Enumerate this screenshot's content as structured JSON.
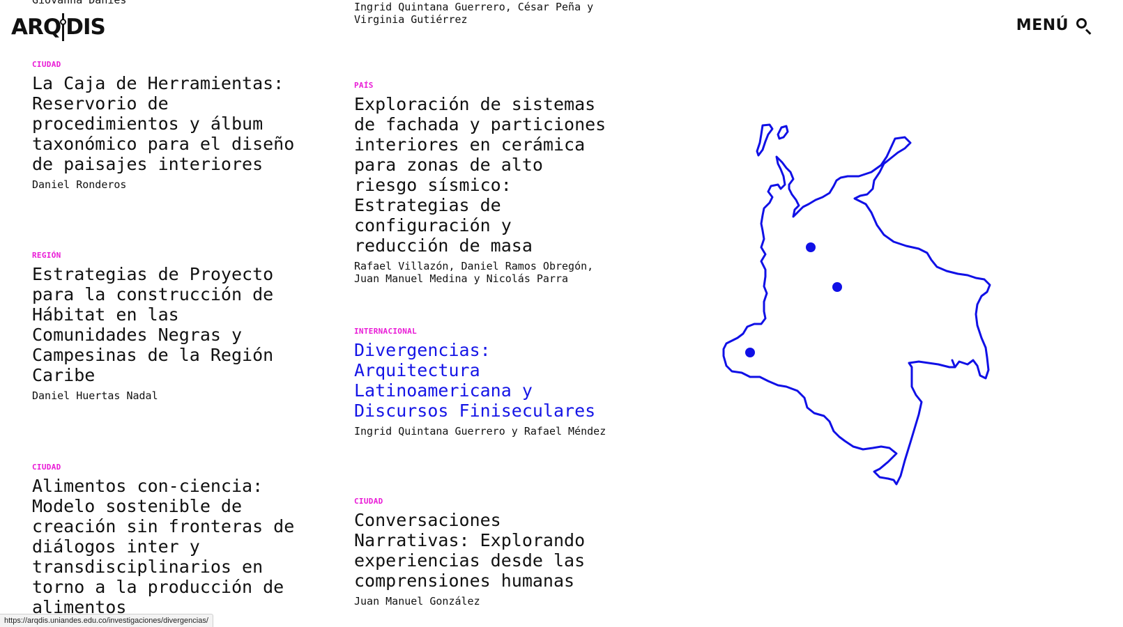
{
  "logo": {
    "left": "ARQ",
    "right": "DIS"
  },
  "header": {
    "menu_label": "MENÚ",
    "search_icon": "search-icon"
  },
  "cut_off": {
    "col1_top": "Giovanna Danies",
    "col2_top": "Ingrid Quintana Guerrero, César Peña y\nVirginia Gutiérrez"
  },
  "column1": [
    {
      "category": "CIUDAD",
      "title": "La Caja de Herramientas: Reservorio de procedimientos y álbum taxonómico para el diseño de paisajes interiores",
      "authors": "Daniel Ronderos"
    },
    {
      "category": "REGIÓN",
      "title": "Estrategias de Proyecto para la construcción de Hábitat en las Comunidades Negras y Campesinas de la Región Caribe",
      "authors": "Daniel Huertas Nadal"
    },
    {
      "category": "CIUDAD",
      "title": "Alimentos con-ciencia: Modelo sostenible de creación sin fronteras de diálogos inter y transdisciplinarios en torno a la producción de alimentos",
      "authors": ""
    }
  ],
  "column2": [
    {
      "category": "PAÍS",
      "title": "Exploración de sistemas de fachada y particiones interiores en cerámica para zonas de alto riesgo sísmico: Estrategias de configuración y reducción de masa",
      "authors": "Rafael Villazón, Daniel Ramos Obregón, Juan Manuel Medina y Nicolás Parra"
    },
    {
      "category": "INTERNACIONAL",
      "title": "Divergencias: Arquitectura Latinoamericana y Discursos Finiseculares",
      "authors": "Ingrid Quintana Guerrero y Rafael Méndez"
    },
    {
      "category": "CIUDAD",
      "title": "Conversaciones Narrativas: Explorando experiencias desde las comprensiones humanas",
      "authors": "Juan Manuel González"
    }
  ],
  "status_url": "https://arqdis.uniandes.edu.co/investigaciones/divergencias/",
  "colors": {
    "accent": "#e91bd6",
    "link": "#1515e6",
    "map": "#1010e6",
    "text": "#111111"
  }
}
